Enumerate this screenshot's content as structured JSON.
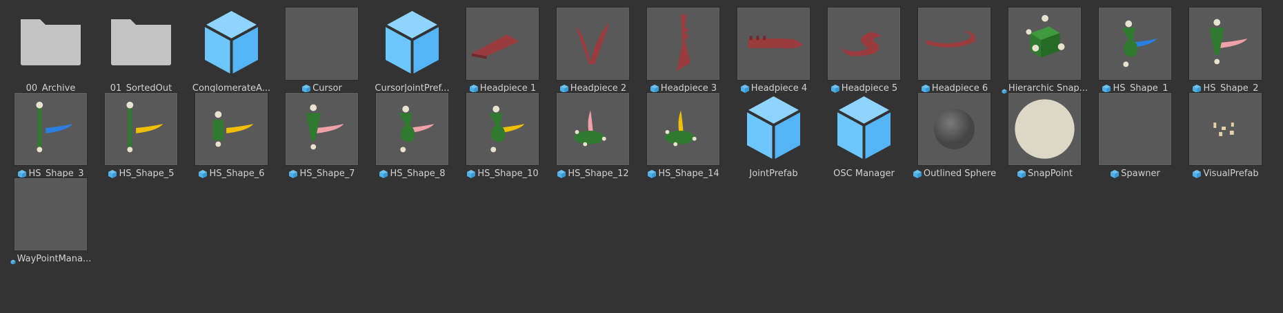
{
  "assets": [
    {
      "name": "00_Archive",
      "kind": "folder",
      "icon": "folder-icon"
    },
    {
      "name": "01_SortedOut",
      "kind": "folder",
      "icon": "folder-icon"
    },
    {
      "name": "ConglomerateA...",
      "kind": "cube",
      "icon": "prefab-cube-icon"
    },
    {
      "name": "Cursor",
      "kind": "blank",
      "icon": "prefab-icon"
    },
    {
      "name": "CursorJointPref...",
      "kind": "cube",
      "icon": "prefab-cube-icon"
    },
    {
      "name": "Headpiece 1",
      "kind": "red",
      "shape": "wedge",
      "icon": "prefab-icon"
    },
    {
      "name": "Headpiece 2",
      "kind": "red",
      "shape": "v",
      "icon": "prefab-icon"
    },
    {
      "name": "Headpiece 3",
      "kind": "red",
      "shape": "spike",
      "icon": "prefab-icon"
    },
    {
      "name": "Headpiece 4",
      "kind": "red",
      "shape": "comb",
      "icon": "prefab-icon"
    },
    {
      "name": "Headpiece 5",
      "kind": "red",
      "shape": "s",
      "icon": "prefab-icon"
    },
    {
      "name": "Headpiece 6",
      "kind": "red",
      "shape": "hook",
      "icon": "prefab-icon"
    },
    {
      "name": "Hierarchic Snap...",
      "kind": "greencube",
      "icon": "prefab-icon-small"
    },
    {
      "name": "HS_Shape_1",
      "kind": "hs",
      "body": "vase",
      "accent": "#2a7fe0",
      "icon": "prefab-icon"
    },
    {
      "name": "HS_Shape_2",
      "kind": "hs",
      "body": "cone",
      "accent": "#f0a0a8",
      "icon": "prefab-icon"
    },
    {
      "name": "HS_Shape_3",
      "kind": "hs",
      "body": "pole",
      "accent": "#2a7fe0",
      "icon": "prefab-icon"
    },
    {
      "name": "HS_Shape_5",
      "kind": "hs",
      "body": "pole",
      "accent": "#f0c000",
      "icon": "prefab-icon"
    },
    {
      "name": "HS_Shape_6",
      "kind": "hs",
      "body": "cyl",
      "accent": "#f0c000",
      "icon": "prefab-icon"
    },
    {
      "name": "HS_Shape_7",
      "kind": "hs",
      "body": "cone",
      "accent": "#f0a0a8",
      "icon": "prefab-icon"
    },
    {
      "name": "HS_Shape_8",
      "kind": "hs",
      "body": "vase",
      "accent": "#f0a0a8",
      "icon": "prefab-icon"
    },
    {
      "name": "HS_Shape_10",
      "kind": "hs",
      "body": "vase",
      "accent": "#f0c000",
      "icon": "prefab-icon"
    },
    {
      "name": "HS_Shape_12",
      "kind": "hs",
      "body": "disc",
      "accent": "#f0a0a8",
      "icon": "prefab-icon"
    },
    {
      "name": "HS_Shape_14",
      "kind": "hs",
      "body": "disc",
      "accent": "#f0c000",
      "icon": "prefab-icon"
    },
    {
      "name": "JointPrefab",
      "kind": "cube",
      "icon": "prefab-cube-icon"
    },
    {
      "name": "OSC Manager",
      "kind": "cube",
      "icon": "prefab-cube-icon"
    },
    {
      "name": "Outlined Sphere",
      "kind": "sphere",
      "icon": "prefab-icon"
    },
    {
      "name": "SnapPoint",
      "kind": "snappoint",
      "icon": "prefab-icon"
    },
    {
      "name": "Spawner",
      "kind": "blank",
      "icon": "prefab-icon"
    },
    {
      "name": "VisualPrefab",
      "kind": "visual",
      "icon": "prefab-icon"
    },
    {
      "name": "WayPointMana...",
      "kind": "blank",
      "icon": "prefab-icon-small"
    }
  ],
  "colors": {
    "folder": "#c4c4c4",
    "cube_top": "#8fd4ff",
    "cube_left": "#6ec6ff",
    "cube_right": "#55b4f5",
    "red": "#9a3b3e",
    "green": "#2f7a2f",
    "prefab_icon": "#6cc3f2"
  }
}
